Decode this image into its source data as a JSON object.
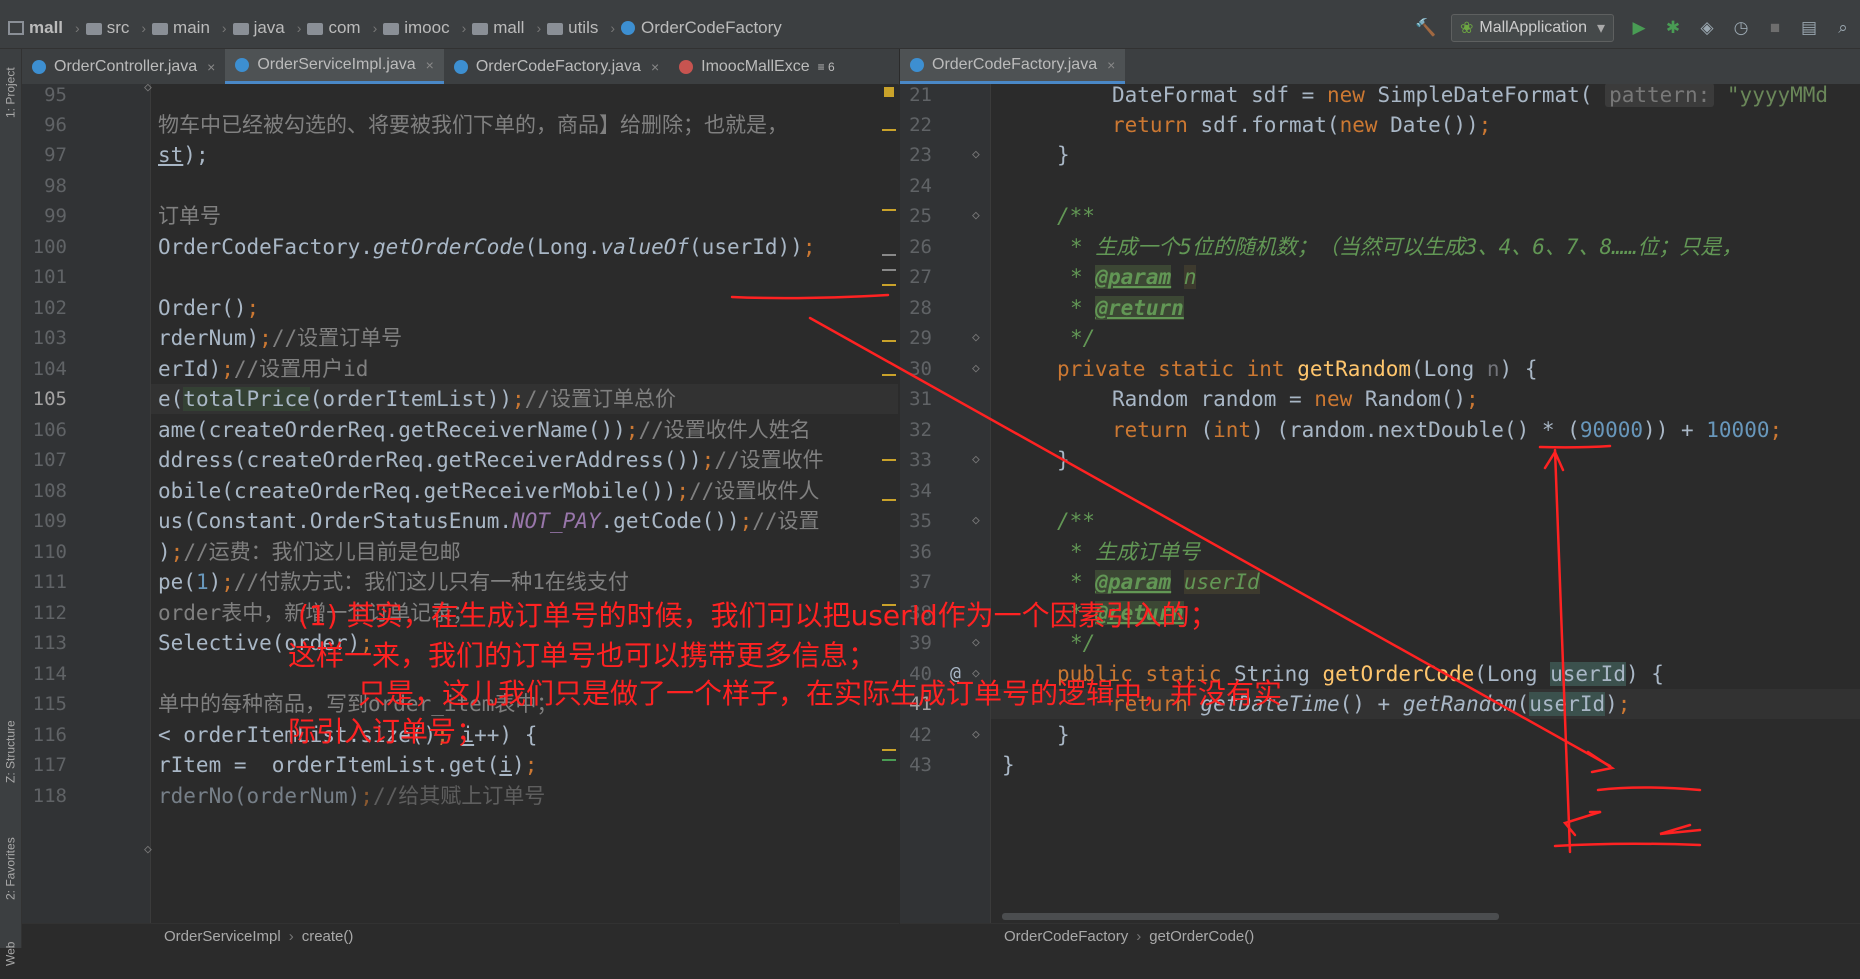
{
  "breadcrumb": [
    "mall",
    "src",
    "main",
    "java",
    "com",
    "imooc",
    "mall",
    "utils",
    "OrderCodeFactory"
  ],
  "run_config": "MallApplication",
  "left_tools": {
    "project": "1: Project",
    "structure": "Z: Structure",
    "favorites": "2: Favorites",
    "web": "Web"
  },
  "left_tabs": [
    {
      "label": "OrderController.java",
      "close": "×"
    },
    {
      "label": "OrderServiceImpl.java",
      "close": "×"
    },
    {
      "label": "OrderCodeFactory.java",
      "close": "×"
    },
    {
      "label": "ImoocMallExce",
      "close": ""
    }
  ],
  "tab_overflow": "≡ 6",
  "right_tabs": [
    {
      "label": "OrderCodeFactory.java",
      "close": "×"
    }
  ],
  "left_editor": {
    "first_line": 95,
    "current_line": 105,
    "line_numbers": [
      "95",
      "96",
      "97",
      "98",
      "99",
      "100",
      "101",
      "102",
      "103",
      "104",
      "105",
      "106",
      "107",
      "108",
      "109",
      "110",
      "111",
      "112",
      "113",
      "114",
      "115",
      "116",
      "117",
      "118"
    ],
    "status": {
      "class": "OrderServiceImpl",
      "method": "create()"
    }
  },
  "right_editor": {
    "current_line": 41,
    "line_numbers": [
      "21",
      "22",
      "23",
      "24",
      "25",
      "26",
      "27",
      "28",
      "29",
      "30",
      "31",
      "32",
      "33",
      "34",
      "35",
      "36",
      "37",
      "38",
      "39",
      "40",
      "41",
      "42",
      "43"
    ],
    "status": {
      "class": "OrderCodeFactory",
      "method": "getOrderCode()"
    }
  },
  "annotation": {
    "line1": "(1) 其实，在生成订单号的时候，我们可以把userId作为一个因素引入的；",
    "line2": "这样一来，我们的订单号也可以携带更多信息；",
    "line3": "只是，这儿我们只是做了一个样子，在实际生成订单号的逻辑中，并没有实",
    "line4": "际引入订单号；",
    "color": "#ff2222"
  },
  "colors": {
    "bg": "#2b2b2b",
    "keyword": "#cc7832",
    "method": "#ffc66d",
    "comment": "#808080",
    "doc": "#629755",
    "number": "#6897bb"
  }
}
